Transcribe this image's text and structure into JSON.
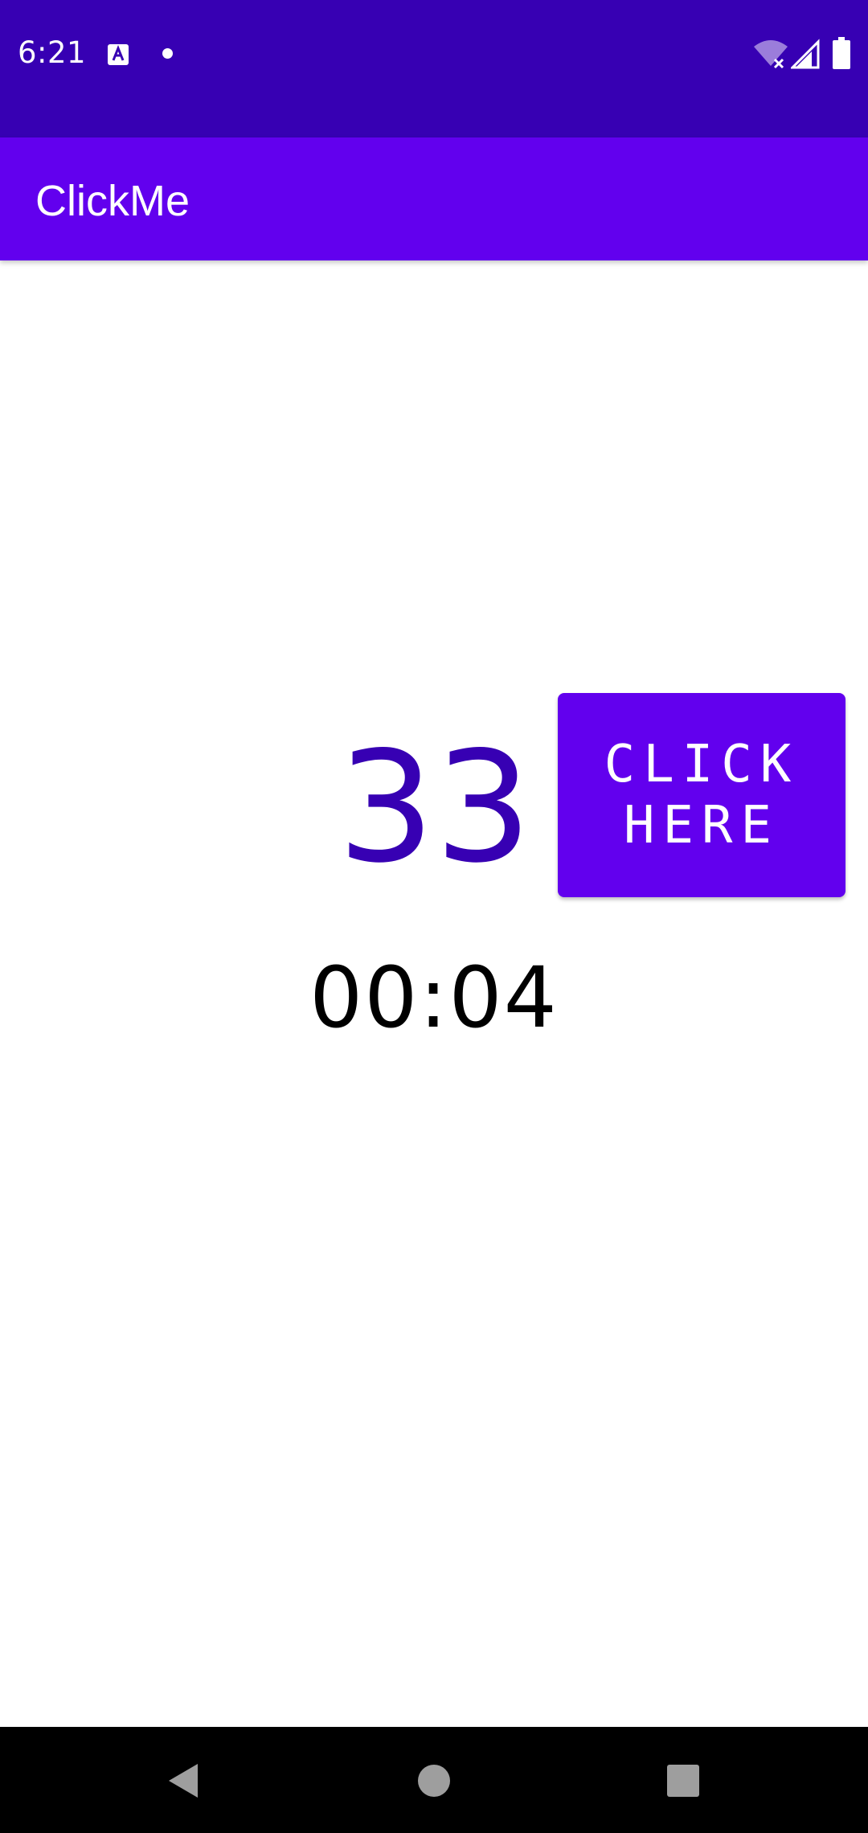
{
  "status_bar": {
    "time": "6:21",
    "icons": [
      "accessibility-app-icon",
      "notification-dot-icon",
      "wifi-off-icon",
      "cell-signal-icon",
      "battery-icon"
    ]
  },
  "app_bar": {
    "title": "ClickMe"
  },
  "main": {
    "counter": "33",
    "button_label": "CLICK\nHERE",
    "timer": "00:04"
  },
  "nav_bar": {
    "icons": [
      "back-icon",
      "home-icon",
      "recents-icon"
    ]
  },
  "colors": {
    "status_bar": "#3700B3",
    "app_bar": "#6200EE",
    "counter_text": "#3700B3",
    "button": "#6200EE",
    "nav_bar": "#000000"
  }
}
